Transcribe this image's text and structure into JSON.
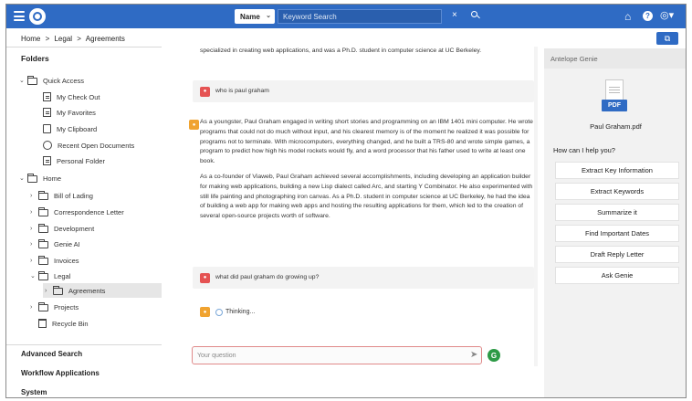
{
  "search": {
    "field_select": "Name",
    "placeholder": "Keyword Search"
  },
  "breadcrumb": [
    "Home",
    ">",
    "Legal",
    ">",
    "Agreements"
  ],
  "sidebar": {
    "title": "Folders",
    "quick_access": "Quick Access",
    "quick_items": [
      "My Check Out",
      "My Favorites",
      "My Clipboard",
      "Recent Open Documents",
      "Personal Folder"
    ],
    "home": "Home",
    "home_items": [
      "Bill of Lading",
      "Correspondence Letter",
      "Development",
      "Genie AI",
      "Invoices",
      "Legal",
      "Agreements",
      "Projects",
      "Recycle Bin"
    ],
    "bottom": [
      "Advanced Search",
      "Workflow Applications",
      "System"
    ]
  },
  "chat": {
    "top_fragment": "specialized in creating web applications, and was a Ph.D. student in computer science at UC Berkeley.",
    "q1": "who is paul graham",
    "a1_p1": "As a youngster, Paul Graham engaged in writing short stories and programming on an IBM 1401 mini computer. He wrote programs that could not do much without input, and his clearest memory is of the moment he realized it was possible for programs not to terminate. With microcomputers, everything changed, and he built a TRS-80 and wrote simple games, a program to predict how high his model rockets would fly, and a word processor that his father used to write at least one book.",
    "a1_p2": "As a co-founder of Viaweb, Paul Graham achieved several accomplishments, including developing an application builder for making web applications, building a new Lisp dialect called Arc, and starting Y Combinator. He also experimented with still life painting and photographing iron canvas. As a Ph.D. student in computer science at UC Berkeley, he had the idea of building a web app for making web apps and hosting the resulting applications for them, which led to the creation of several open-source projects worth of software.",
    "q2": "what did paul graham do growing up?",
    "thinking": "Thinking...",
    "input_placeholder": "Your question",
    "genie_initial": "G"
  },
  "panel": {
    "title": "Antelope Genie",
    "file_badge": "PDF",
    "file_name": "Paul Graham.pdf",
    "help_prompt": "How can I help you?",
    "actions": [
      "Extract Key Information",
      "Extract Keywords",
      "Summarize it",
      "Find Important Dates",
      "Draft Reply Letter",
      "Ask Genie"
    ]
  },
  "colors": {
    "brand": "#2f6bc4",
    "user_avatar": "#e55353",
    "bot_avatar": "#f0a330",
    "genie_button": "#2d9a46"
  },
  "icons": [
    "menu-icon",
    "logo-icon",
    "search-icon",
    "clear-icon",
    "home-icon",
    "help-icon",
    "user-icon",
    "chat-icon",
    "send-icon"
  ]
}
